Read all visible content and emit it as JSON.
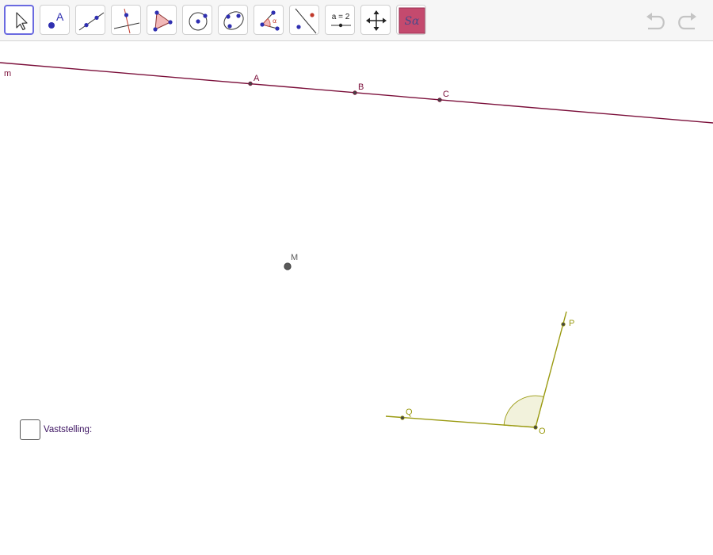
{
  "toolbar": {
    "tools": [
      {
        "id": "move",
        "icon": "cursor-arrow-icon",
        "selected": true
      },
      {
        "id": "point",
        "icon": "point-icon",
        "icon_text": "A"
      },
      {
        "id": "line",
        "icon": "line-through-points-icon"
      },
      {
        "id": "perpendicular",
        "icon": "perpendicular-line-icon"
      },
      {
        "id": "polygon",
        "icon": "polygon-icon"
      },
      {
        "id": "circle",
        "icon": "circle-center-point-icon"
      },
      {
        "id": "ellipse",
        "icon": "ellipse-icon"
      },
      {
        "id": "angle",
        "icon": "angle-icon",
        "icon_text": "α"
      },
      {
        "id": "reflect",
        "icon": "reflect-about-line-icon"
      },
      {
        "id": "slider",
        "icon": "slider-icon",
        "icon_text": "a = 2"
      },
      {
        "id": "move-view",
        "icon": "move-graphics-view-icon"
      },
      {
        "id": "custom-tool",
        "icon": "custom-tool-icon",
        "icon_text": "Sα"
      }
    ],
    "undo_icon": "undo-icon",
    "redo_icon": "redo-icon"
  },
  "construction": {
    "line_name": "m",
    "points_on_line": [
      "A",
      "B",
      "C"
    ],
    "free_point": "M",
    "angle_points": {
      "vertex": "O",
      "ray1": "P",
      "ray2": "Q"
    },
    "colors": {
      "line": "#7b0f3a",
      "line_labels": "#7b0f3a",
      "free_point": "#5a5a5a",
      "angle": "#9a9a10",
      "angle_fill": "#f2f2dc",
      "checkbox_label": "#3c1361"
    }
  },
  "checkbox": {
    "label": "Vaststelling:",
    "checked": false
  }
}
